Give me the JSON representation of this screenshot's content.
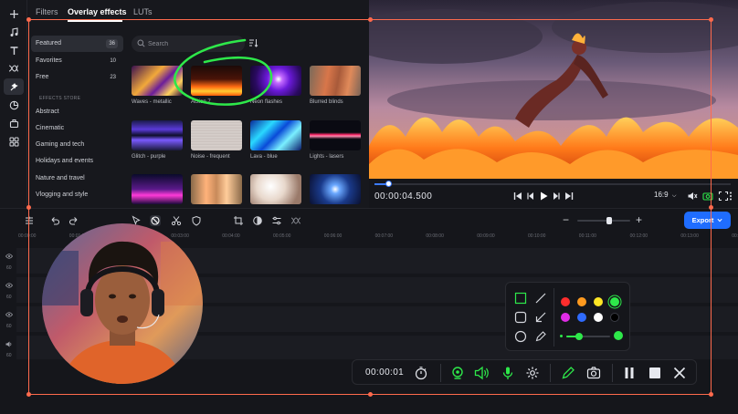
{
  "rail": {
    "items": [
      {
        "icon": "plus-icon"
      },
      {
        "icon": "music-icon"
      },
      {
        "icon": "text-icon"
      },
      {
        "icon": "transitions-icon"
      },
      {
        "icon": "effects-icon",
        "active": true
      },
      {
        "icon": "stickers-icon"
      },
      {
        "icon": "plugins-icon"
      },
      {
        "icon": "templates-icon"
      }
    ]
  },
  "panel": {
    "tabs": [
      {
        "label": "Filters"
      },
      {
        "label": "Overlay effects",
        "active": true
      },
      {
        "label": "LUTs"
      }
    ],
    "categories": [
      {
        "label": "Featured",
        "count": "36",
        "active": true
      },
      {
        "label": "Favorites",
        "count": "10"
      },
      {
        "label": "Free",
        "count": "23"
      }
    ],
    "store_heading": "EFFECTS STORE",
    "store_categories": [
      "Abstract",
      "Cinematic",
      "Gaming and tech",
      "Holidays and events",
      "Nature and travel",
      "Vlogging and style"
    ],
    "search": {
      "placeholder": "Search"
    },
    "thumbnails": [
      {
        "label": "Waves - metallic"
      },
      {
        "label": "Action 7"
      },
      {
        "label": "Neon flashes"
      },
      {
        "label": "Blurred blinds"
      },
      {
        "label": "Glitch - purple"
      },
      {
        "label": "Noise - frequent"
      },
      {
        "label": "Lava - blue"
      },
      {
        "label": "Lights - lasers"
      },
      {
        "label": ""
      },
      {
        "label": ""
      },
      {
        "label": ""
      },
      {
        "label": ""
      }
    ]
  },
  "preview": {
    "timecode": "00:00:04.500",
    "progress": 0.04,
    "aspect": "16:9"
  },
  "toolbar": {
    "export_label": "Export",
    "zoom": 0.6
  },
  "timeline": {
    "ticks": [
      "00:00:00",
      "00:01:00",
      "00:02:00",
      "00:03:00",
      "00:04:00",
      "00:05:00",
      "00:06:00",
      "00:07:00",
      "00:08:00",
      "00:09:00",
      "00:10:00",
      "00:11:00",
      "00:12:00",
      "00:13:00",
      "00:14:00"
    ],
    "tracks": [
      {
        "icon": "eye-icon",
        "num": "60"
      },
      {
        "icon": "eye-icon",
        "num": "60"
      },
      {
        "icon": "eye-icon",
        "num": "60"
      },
      {
        "icon": "audio-icon",
        "num": "60"
      }
    ]
  },
  "palette": {
    "colors": [
      "#ff2d2d",
      "#ff9a1f",
      "#ffe625",
      "#2ee84a",
      "#e02ce6",
      "#2f6bff",
      "#ffffff",
      "#000000"
    ],
    "selected_color": "#2ee84a",
    "brush_size": 0.3
  },
  "recbar": {
    "time": "00:00:01"
  },
  "colors": {
    "accent": "#1f6dff",
    "frame": "#ff6a4d",
    "record_green": "#2ee84a"
  }
}
